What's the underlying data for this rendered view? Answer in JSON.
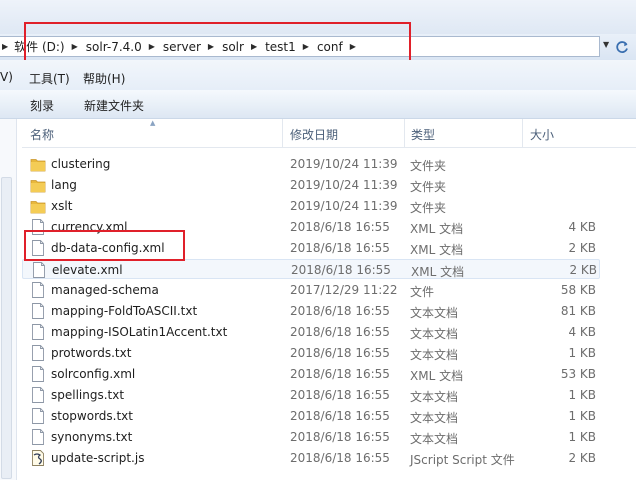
{
  "address": {
    "crumbs": [
      "软件 (D:)",
      "solr-7.4.0",
      "server",
      "solr",
      "test1",
      "conf"
    ]
  },
  "menu": {
    "partial": "V)",
    "tools": "工具(T)",
    "help": "帮助(H)"
  },
  "toolbar": {
    "burn": "刻录",
    "new_folder": "新建文件夹"
  },
  "columns": {
    "name": "名称",
    "date": "修改日期",
    "type": "类型",
    "size": "大小"
  },
  "files": [
    {
      "name": "clustering",
      "date": "2019/10/24 11:39",
      "type": "文件夹",
      "size": "",
      "icon": "folder"
    },
    {
      "name": "lang",
      "date": "2019/10/24 11:39",
      "type": "文件夹",
      "size": "",
      "icon": "folder"
    },
    {
      "name": "xslt",
      "date": "2019/10/24 11:39",
      "type": "文件夹",
      "size": "",
      "icon": "folder"
    },
    {
      "name": "currency.xml",
      "date": "2018/6/18 16:55",
      "type": "XML 文档",
      "size": "4 KB",
      "icon": "file"
    },
    {
      "name": "db-data-config.xml",
      "date": "2018/6/18 16:55",
      "type": "XML 文档",
      "size": "2 KB",
      "icon": "file"
    },
    {
      "name": "elevate.xml",
      "date": "2018/6/18 16:55",
      "type": "XML 文档",
      "size": "2 KB",
      "icon": "file"
    },
    {
      "name": "managed-schema",
      "date": "2017/12/29 11:22",
      "type": "文件",
      "size": "58 KB",
      "icon": "file"
    },
    {
      "name": "mapping-FoldToASCII.txt",
      "date": "2018/6/18 16:55",
      "type": "文本文档",
      "size": "81 KB",
      "icon": "file"
    },
    {
      "name": "mapping-ISOLatin1Accent.txt",
      "date": "2018/6/18 16:55",
      "type": "文本文档",
      "size": "4 KB",
      "icon": "file"
    },
    {
      "name": "protwords.txt",
      "date": "2018/6/18 16:55",
      "type": "文本文档",
      "size": "1 KB",
      "icon": "file"
    },
    {
      "name": "solrconfig.xml",
      "date": "2018/6/18 16:55",
      "type": "XML 文档",
      "size": "53 KB",
      "icon": "file"
    },
    {
      "name": "spellings.txt",
      "date": "2018/6/18 16:55",
      "type": "文本文档",
      "size": "1 KB",
      "icon": "file"
    },
    {
      "name": "stopwords.txt",
      "date": "2018/6/18 16:55",
      "type": "文本文档",
      "size": "1 KB",
      "icon": "file"
    },
    {
      "name": "synonyms.txt",
      "date": "2018/6/18 16:55",
      "type": "文本文档",
      "size": "1 KB",
      "icon": "file"
    },
    {
      "name": "update-script.js",
      "date": "2018/6/18 16:55",
      "type": "JScript Script 文件",
      "size": "2 KB",
      "icon": "script"
    }
  ],
  "selected_index": 5,
  "accent_colors": {
    "highlight": "#e0202a",
    "folder": "#e8b83c"
  }
}
